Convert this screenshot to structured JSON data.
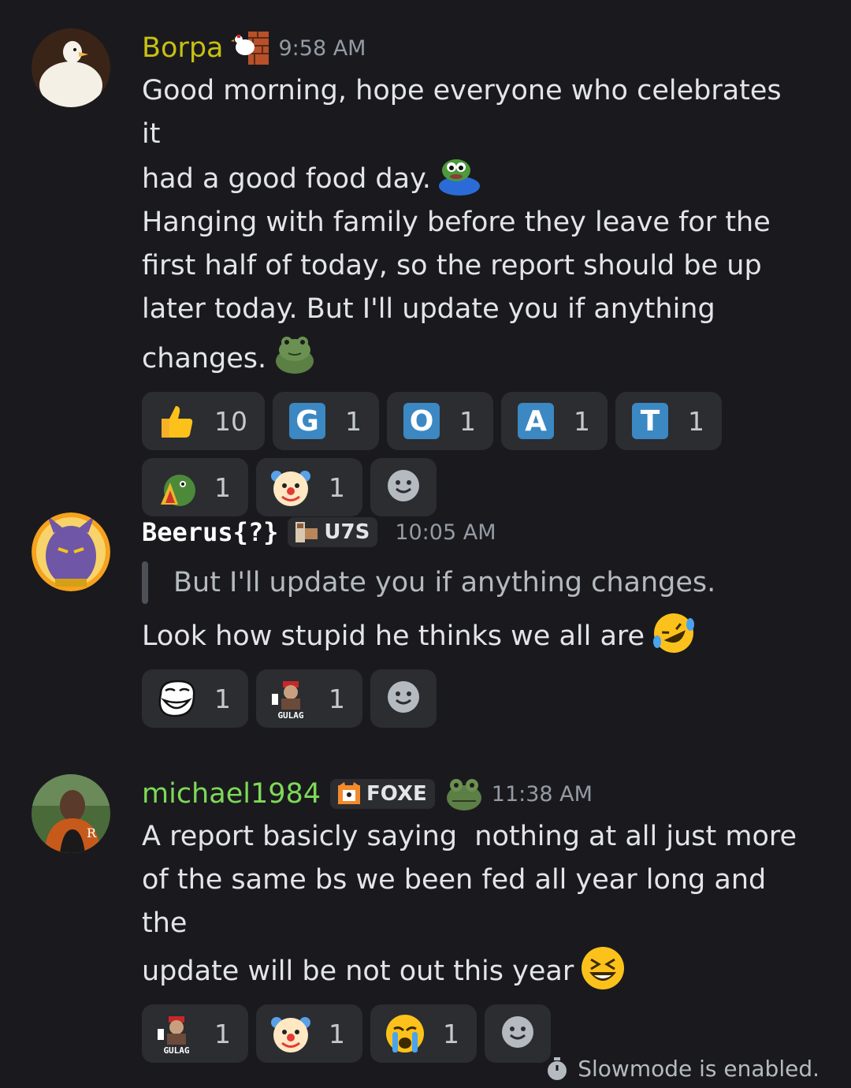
{
  "messages": [
    {
      "username": "Borpa",
      "username_color": "#c7c013",
      "timestamp": "9:58 AM",
      "lines": [
        "Good morning, hope everyone who celebrates it",
        "had a good food day.",
        "Hanging with family before they leave for the",
        "first half of today, so the report should be up",
        "later today. But I'll update you if anything",
        "changes."
      ],
      "reactions": [
        {
          "emoji": "thumbs-up",
          "count": "10"
        },
        {
          "emoji": "letter-G",
          "letter": "G",
          "count": "1"
        },
        {
          "emoji": "letter-O",
          "letter": "O",
          "count": "1"
        },
        {
          "emoji": "letter-A",
          "letter": "A",
          "count": "1"
        },
        {
          "emoji": "letter-T",
          "letter": "T",
          "count": "1"
        },
        {
          "emoji": "pepe-fire",
          "count": "1"
        },
        {
          "emoji": "clown",
          "count": "1"
        }
      ]
    },
    {
      "username": "Beerus{?}",
      "username_color": "#ffffff",
      "tag": "U7S",
      "timestamp": "10:05 AM",
      "quote": "But I'll update you if anything changes.",
      "text": "Look how stupid he thinks we all are",
      "reactions": [
        {
          "emoji": "trollface",
          "count": "1"
        },
        {
          "emoji": "gulag",
          "label": "GULAG",
          "count": "1"
        }
      ]
    },
    {
      "username": "michael1984",
      "username_color": "#7ed957",
      "tag": "FOXE",
      "timestamp": "11:38 AM",
      "lines": [
        "A report basicly saying  nothing at all just more",
        "of the same bs we been fed all year long and the",
        "update will be not out this year"
      ],
      "reactions": [
        {
          "emoji": "gulag",
          "label": "GULAG",
          "count": "1"
        },
        {
          "emoji": "clown",
          "count": "1"
        },
        {
          "emoji": "crying",
          "count": "1"
        }
      ]
    }
  ],
  "footer": {
    "slowmode": "Slowmode is enabled."
  }
}
